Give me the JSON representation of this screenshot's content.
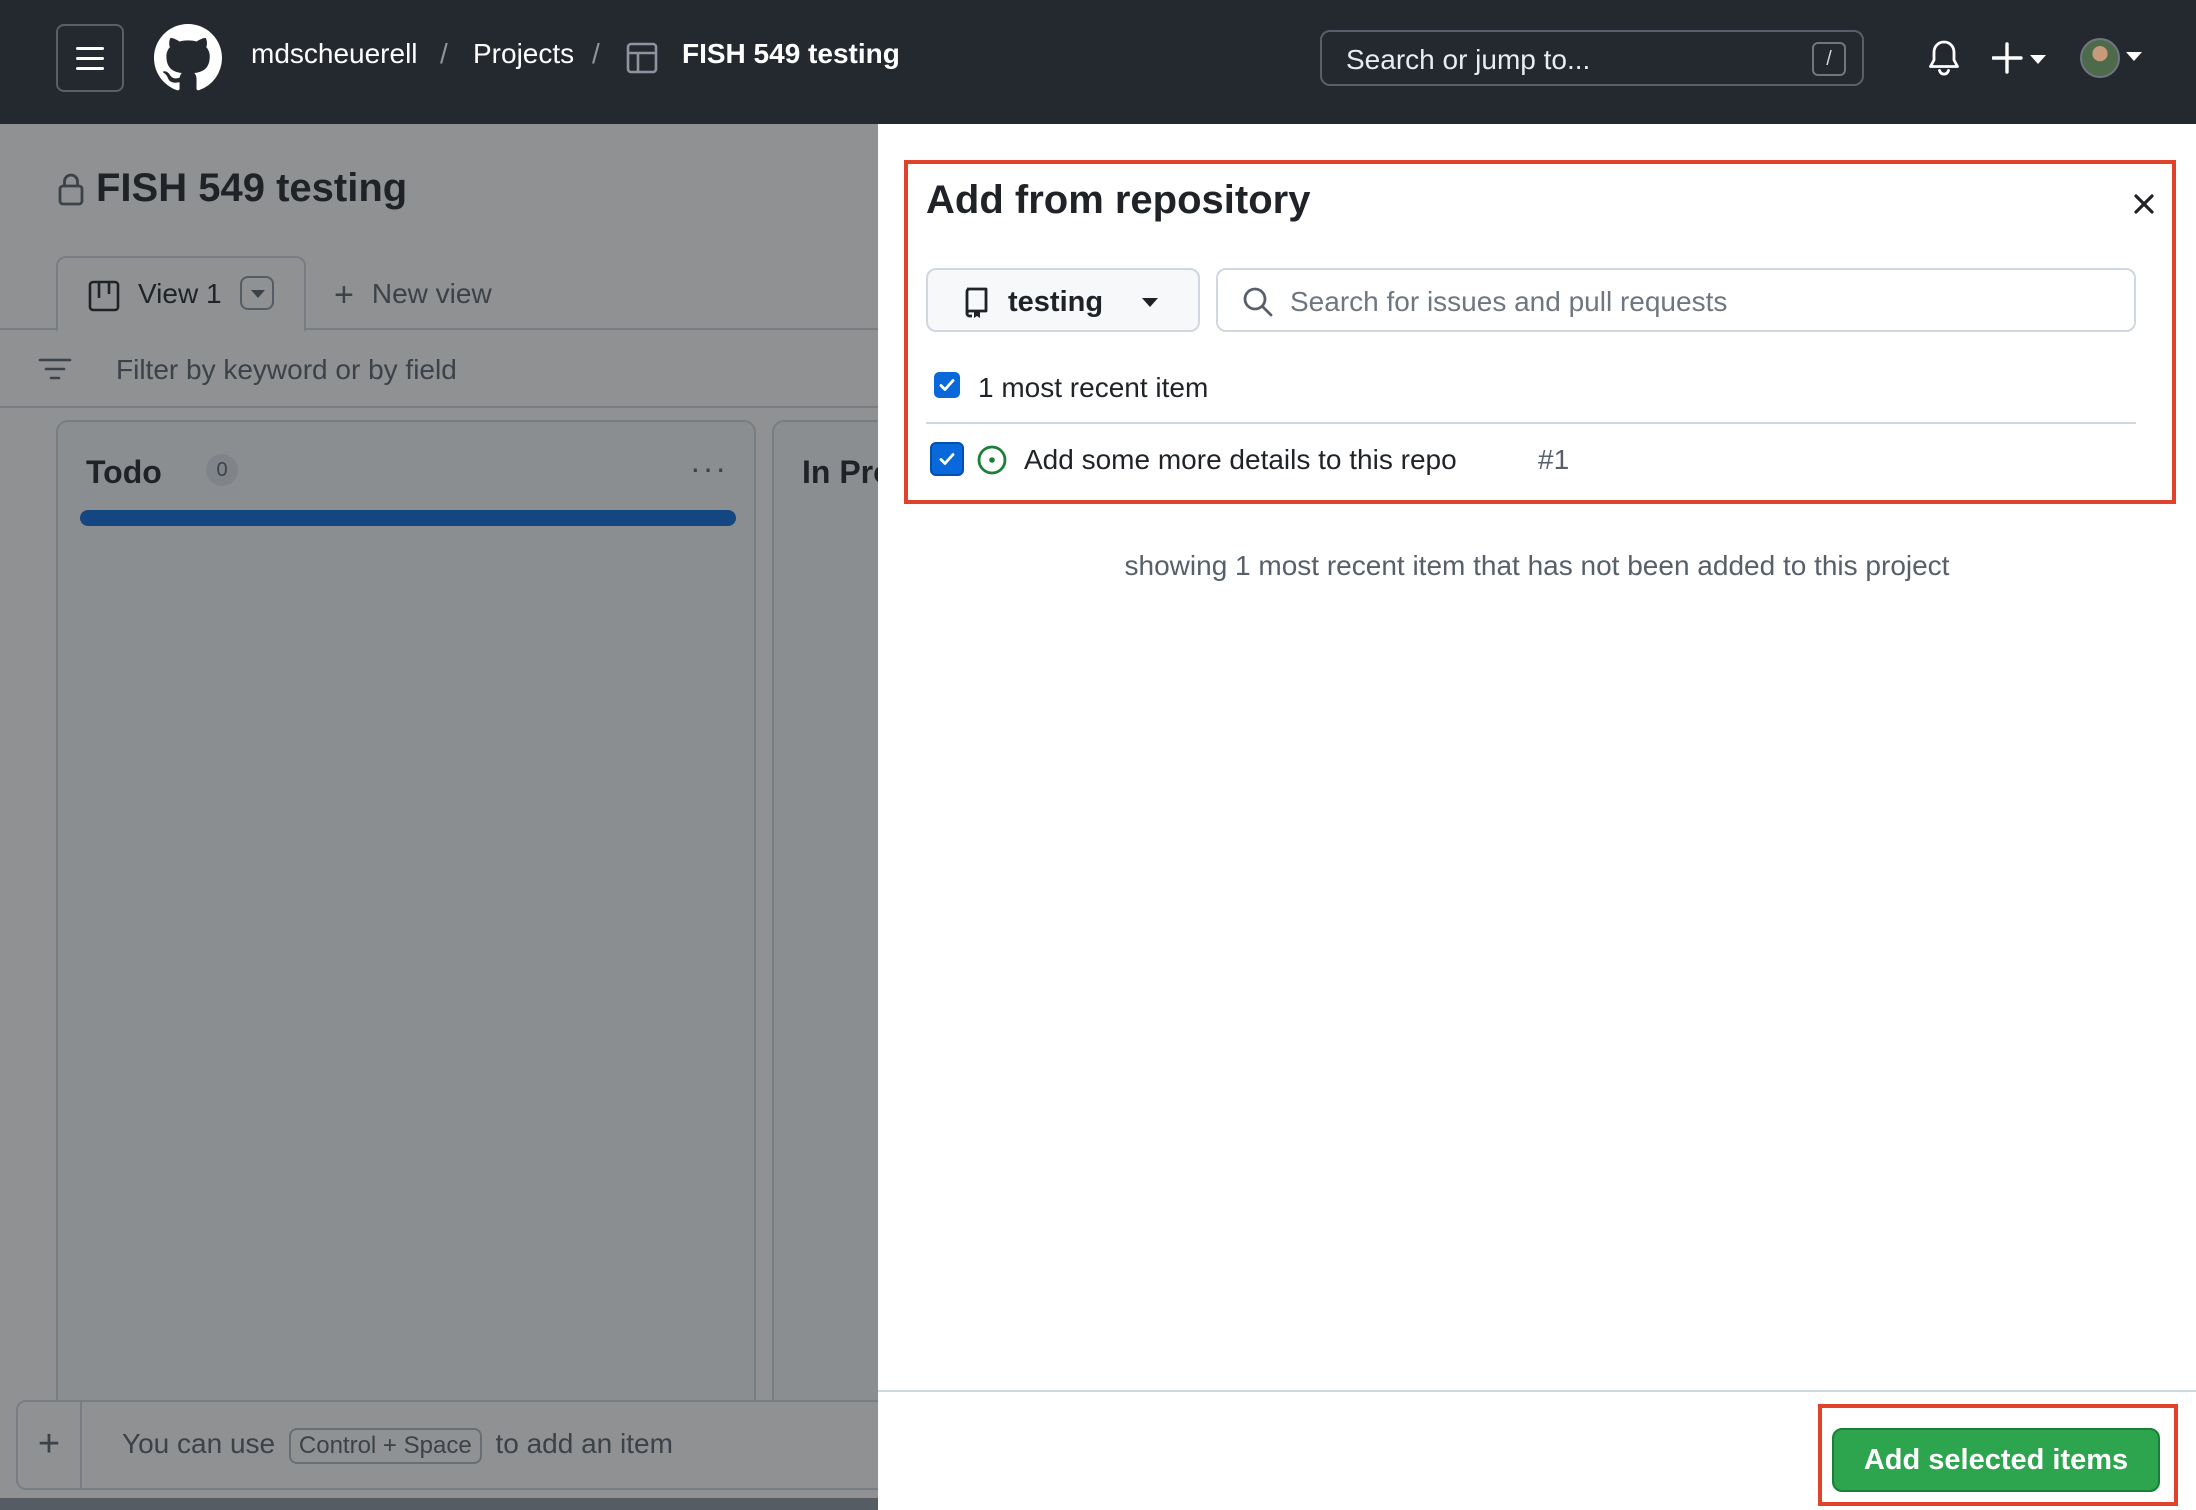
{
  "header": {
    "owner": "mdscheuerell",
    "separator": "/",
    "projects": "Projects",
    "project_name": "FISH 549 testing",
    "search_placeholder": "Search or jump to...",
    "search_shortcut": "/"
  },
  "board": {
    "title": "FISH 549 testing",
    "tabs": [
      {
        "label": "View 1"
      }
    ],
    "new_view_label": "New view",
    "filter_placeholder": "Filter by keyword or by field",
    "columns": [
      {
        "name": "Todo",
        "count": "0"
      },
      {
        "name": "In Pro"
      }
    ],
    "add_item_prefix": "You can use",
    "add_item_shortcut": "Control + Space",
    "add_item_suffix": "to add an item"
  },
  "panel": {
    "title": "Add from repository",
    "repo_selected": "testing",
    "search_placeholder": "Search for issues and pull requests",
    "select_all_label": "1 most recent item",
    "select_all_checked": true,
    "items": [
      {
        "title": "Add some more details to this repo",
        "number": "#1",
        "checked": true,
        "state": "open"
      }
    ],
    "hint": "showing 1 most recent item that has not been added to this project",
    "submit_label": "Add selected items"
  },
  "colors": {
    "header_bg": "#24292f",
    "accent_blue": "#0969da",
    "primary_green": "#2da44e",
    "open_issue_green": "#1a7f37",
    "highlight_red": "#e0432a"
  },
  "icons": [
    "menu-icon",
    "github-logo-icon",
    "table-icon",
    "bell-icon",
    "plus-icon",
    "lock-icon",
    "board-icon",
    "filter-icon",
    "repo-icon",
    "search-icon",
    "close-icon",
    "issue-open-icon",
    "check-icon"
  ]
}
